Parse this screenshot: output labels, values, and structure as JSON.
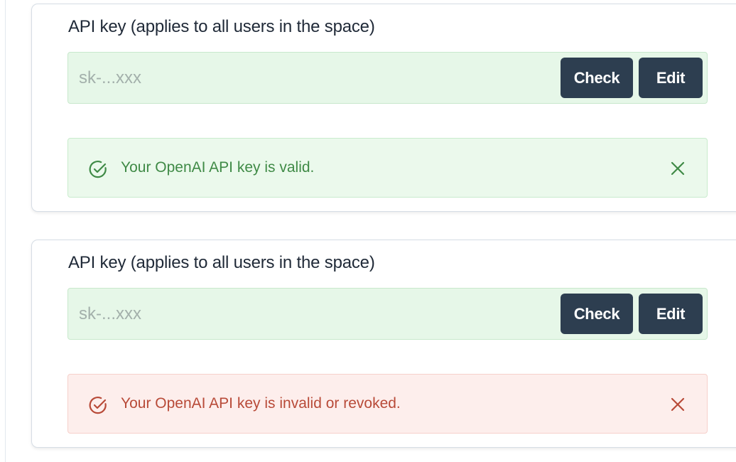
{
  "panels": [
    {
      "field_label": "API key (applies to all users in the space)",
      "key_placeholder": "sk-...xxx",
      "check_label": "Check",
      "edit_label": "Edit",
      "alert": {
        "message": "Your OpenAI API key is valid.",
        "status": "success",
        "icon": "check-circle-icon",
        "color": "#3f8a46"
      }
    },
    {
      "field_label": "API key (applies to all users in the space)",
      "key_placeholder": "sk-...xxx",
      "check_label": "Check",
      "edit_label": "Edit",
      "alert": {
        "message": "Your OpenAI API key is invalid or revoked.",
        "status": "error",
        "icon": "check-circle-icon",
        "color": "#b84a38"
      }
    }
  ],
  "colors": {
    "button_bg": "#2d3e50",
    "input_bg": "#e6f7e8",
    "success_bg": "#ebf9ec",
    "error_bg": "#fdeeec"
  }
}
